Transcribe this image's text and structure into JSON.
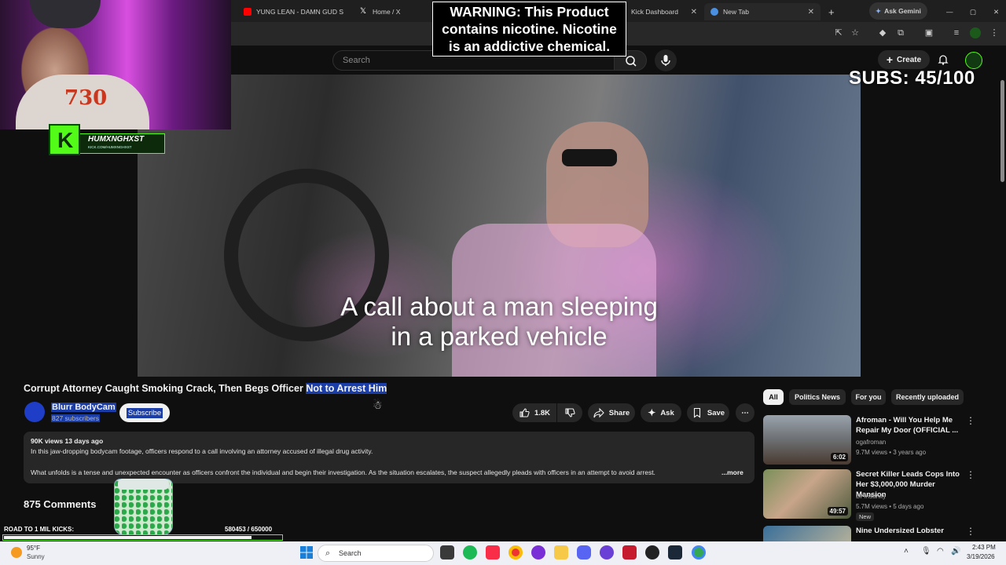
{
  "browser": {
    "tabs": [
      {
        "title": "YUNG LEAN - DAMN GUD S",
        "icon": "youtube-icon",
        "color": "#ff0000"
      },
      {
        "title": "Home / X",
        "icon": "x-icon",
        "color": "#ffffff"
      },
      {
        "title": "Kick Dashboard",
        "icon": "kick-icon",
        "color": "#53fc18"
      },
      {
        "title": "New Tab",
        "icon": "chrome-icon",
        "color": "#4a90e2"
      }
    ],
    "new_tab": "+",
    "gemini": "Ask Gemini"
  },
  "youtube": {
    "search_placeholder": "Search",
    "create_label": "Create"
  },
  "overlay": {
    "warning_lines": [
      "WARNING: This Product",
      "contains nicotine. Nicotine",
      "is an addictive chemical."
    ],
    "subs_text": "SUBS: 45/100",
    "kick_name": "HUMXNGHXST",
    "kick_url": "KICK.COM/HUMXNGHXST",
    "webcam_shirt_text": "730",
    "road_label": "ROAD TO 1 MIL KICKS:",
    "road_count": "580453   / 650000",
    "road_progress": 0.893
  },
  "video": {
    "caption_line1": "A call about a man sleeping",
    "caption_line2": "in a parked vehicle",
    "title_main": "Corrupt Attorney Caught Smoking Crack, Then Begs Officer ",
    "title_highlight": "Not to Arrest Him",
    "channel_name": "Blurr BodyCam",
    "channel_subs": "827 subscribers",
    "subscribe_label": "Subscribe",
    "likes": "1.8K",
    "share_label": "Share",
    "ask_label": "Ask",
    "save_label": "Save",
    "views_date": "90K views  13 days ago",
    "desc_line1": "In this jaw-dropping bodycam footage, officers respond to a call involving an attorney accused of illegal drug activity.",
    "desc_line2": "What unfolds is a tense and unexpected encounter as officers confront the individual and begin their investigation. As the situation escalates, the suspect allegedly pleads with officers in an attempt to avoid arrest.",
    "desc_more": "...more",
    "comments": "875 Comments"
  },
  "sidebar": {
    "chips": [
      "All",
      "Politics News",
      "For you",
      "Recently uploaded"
    ],
    "recs": [
      {
        "title": "Afroman - Will You Help Me Repair My Door (OFFICIAL ...",
        "channel": "ogafroman",
        "meta": "9.7M views • 3 years ago",
        "duration": "6:02",
        "new": ""
      },
      {
        "title": "Secret Killer Leads Cops Into Her $3,000,000 Murder Mansion",
        "channel": "Dr Insanity",
        "meta": "5.7M views • 5 days ago",
        "duration": "49:57",
        "new": "New"
      },
      {
        "title": "Nine Undersized Lobster",
        "channel": "",
        "meta": "",
        "duration": "",
        "new": ""
      }
    ]
  },
  "taskbar": {
    "temp": "95°F",
    "weather": "Sunny",
    "search": "Search",
    "time": "2:43 PM",
    "date": "3/19/2026"
  }
}
